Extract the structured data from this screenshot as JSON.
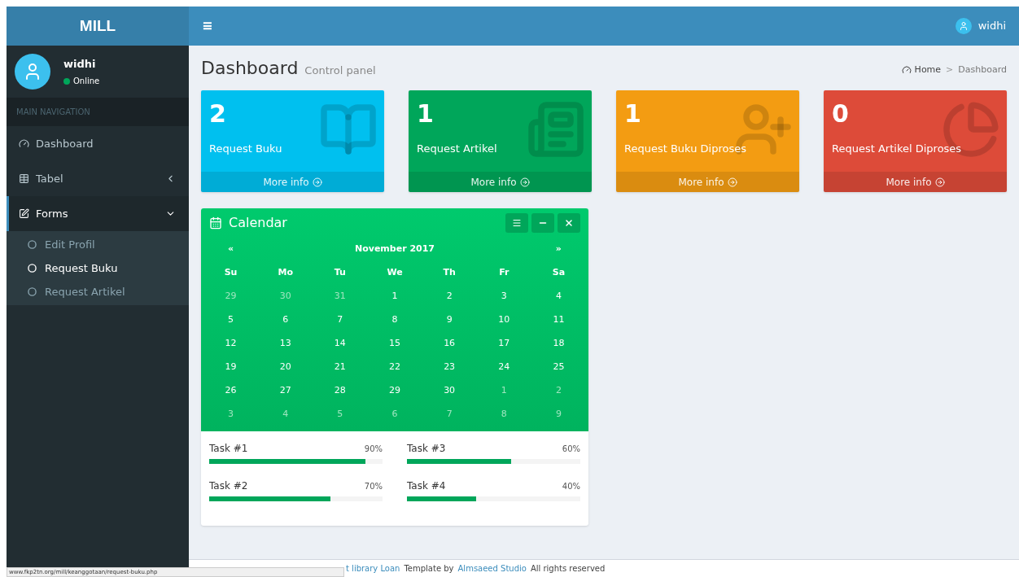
{
  "brand": "MILL",
  "header": {
    "menu_glyph": "≡",
    "user": "widhi"
  },
  "user_panel": {
    "name": "widhi",
    "status": "Online",
    "online": true
  },
  "nav_header": "MAIN NAVIGATION",
  "sidebar": {
    "items": [
      {
        "label": "Dashboard",
        "kind": "link",
        "selected": false
      },
      {
        "label": "Tabel",
        "kind": "tree",
        "expanded": false,
        "selected": false
      },
      {
        "label": "Forms",
        "kind": "tree",
        "expanded": true,
        "selected": true,
        "children": [
          {
            "label": "Edit Profil",
            "selected": false
          },
          {
            "label": "Request Buku",
            "selected": true
          },
          {
            "label": "Request Artikel",
            "selected": false
          }
        ]
      }
    ]
  },
  "page": {
    "title": "Dashboard",
    "subtitle": "Control panel"
  },
  "breadcrumb": [
    "Home",
    "Dashboard"
  ],
  "breadcrumb_separator": ">",
  "stat_boxes": [
    {
      "count": "2",
      "label": "Request Buku",
      "link": "More info",
      "color": "#00c0ef"
    },
    {
      "count": "1",
      "label": "Request Artikel",
      "link": "More info",
      "color": "#00a65a"
    },
    {
      "count": "1",
      "label": "Request Buku Diproses",
      "link": "More info",
      "color": "#f39c12"
    },
    {
      "count": "0",
      "label": "Request Artikel Diproses",
      "link": "More info",
      "color": "#dd4b39"
    }
  ],
  "calendar": {
    "title": "Calendar",
    "prev": "«",
    "month": "November 2017",
    "next": "»",
    "weekdays": [
      "Su",
      "Mo",
      "Tu",
      "We",
      "Th",
      "Fr",
      "Sa"
    ],
    "weeks": [
      [
        {
          "day": "29",
          "other": true
        },
        {
          "day": "30",
          "other": true
        },
        {
          "day": "31",
          "other": true
        },
        {
          "day": "1",
          "other": false
        },
        {
          "day": "2",
          "other": false
        },
        {
          "day": "3",
          "other": false
        },
        {
          "day": "4",
          "other": false
        }
      ],
      [
        {
          "day": "5",
          "other": false
        },
        {
          "day": "6",
          "other": false
        },
        {
          "day": "7",
          "other": false
        },
        {
          "day": "8",
          "other": false
        },
        {
          "day": "9",
          "other": false
        },
        {
          "day": "10",
          "other": false
        },
        {
          "day": "11",
          "other": false
        }
      ],
      [
        {
          "day": "12",
          "other": false
        },
        {
          "day": "13",
          "other": false
        },
        {
          "day": "14",
          "other": false
        },
        {
          "day": "15",
          "other": false
        },
        {
          "day": "16",
          "other": false
        },
        {
          "day": "17",
          "other": false
        },
        {
          "day": "18",
          "other": false
        }
      ],
      [
        {
          "day": "19",
          "other": false
        },
        {
          "day": "20",
          "other": false
        },
        {
          "day": "21",
          "other": false
        },
        {
          "day": "22",
          "other": false
        },
        {
          "day": "23",
          "other": false
        },
        {
          "day": "24",
          "other": false
        },
        {
          "day": "25",
          "other": false
        }
      ],
      [
        {
          "day": "26",
          "other": false
        },
        {
          "day": "27",
          "other": false
        },
        {
          "day": "28",
          "other": false
        },
        {
          "day": "29",
          "other": false
        },
        {
          "day": "30",
          "other": false
        },
        {
          "day": "1",
          "other": true
        },
        {
          "day": "2",
          "other": true
        }
      ],
      [
        {
          "day": "3",
          "other": true
        },
        {
          "day": "4",
          "other": true
        },
        {
          "day": "5",
          "other": true
        },
        {
          "day": "6",
          "other": true
        },
        {
          "day": "7",
          "other": true
        },
        {
          "day": "8",
          "other": true
        },
        {
          "day": "9",
          "other": true
        }
      ]
    ],
    "tasks": [
      {
        "label": "Task #1",
        "reading": "90%",
        "level": 0.9
      },
      {
        "label": "Task #3",
        "reading": "60%",
        "level": 0.6
      },
      {
        "label": "Task #2",
        "reading": "70%",
        "level": 0.7
      },
      {
        "label": "Task #4",
        "reading": "40%",
        "level": 0.4
      }
    ]
  },
  "footer": [
    {
      "text": "t library Loan",
      "link": true
    },
    {
      "text": "Template by",
      "link": false
    },
    {
      "text": "Almsaeed Studio",
      "link": true
    },
    {
      "text": "All rights reserved",
      "link": false
    }
  ],
  "status_url": "www.fkp2tn.org/mill/keanggotaan/request-buku.php"
}
